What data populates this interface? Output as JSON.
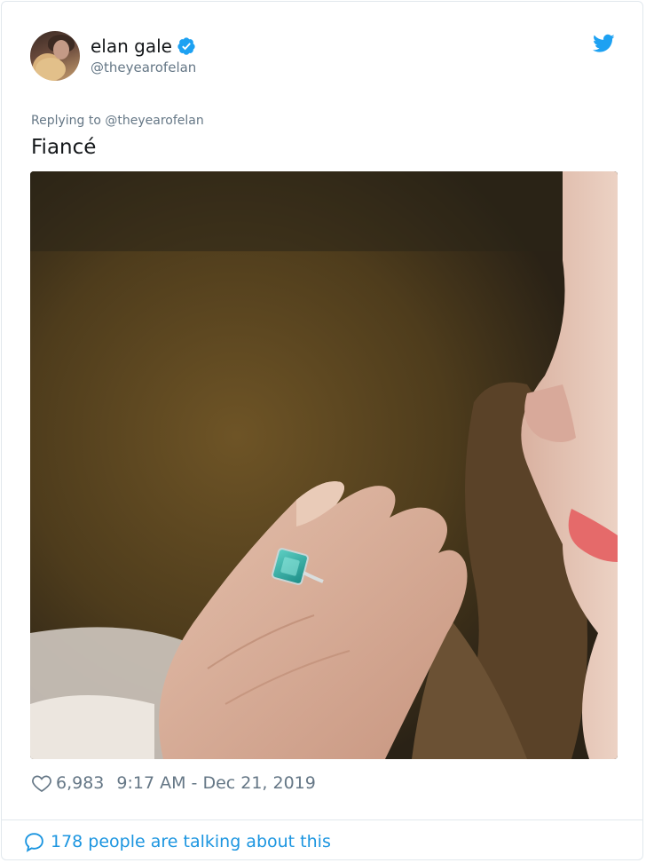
{
  "tweet": {
    "author": {
      "display_name": "elan gale",
      "handle": "@theyearofelan",
      "verified": true
    },
    "reply_to": "Replying to @theyearofelan",
    "text": "Fiancé",
    "likes": "6,983",
    "timestamp": "9:17 AM - Dec 21, 2019",
    "conversation": "178 people are talking about this"
  },
  "icons": {
    "verified": "verified-badge-icon",
    "bird": "twitter-bird-icon",
    "heart": "heart-icon",
    "comment": "speech-bubble-icon"
  },
  "colors": {
    "brand_blue": "#1da1f2",
    "link_blue": "#1b95e0",
    "muted_gray": "#657786",
    "text_dark": "#14171a",
    "border": "#e1e8ed"
  }
}
